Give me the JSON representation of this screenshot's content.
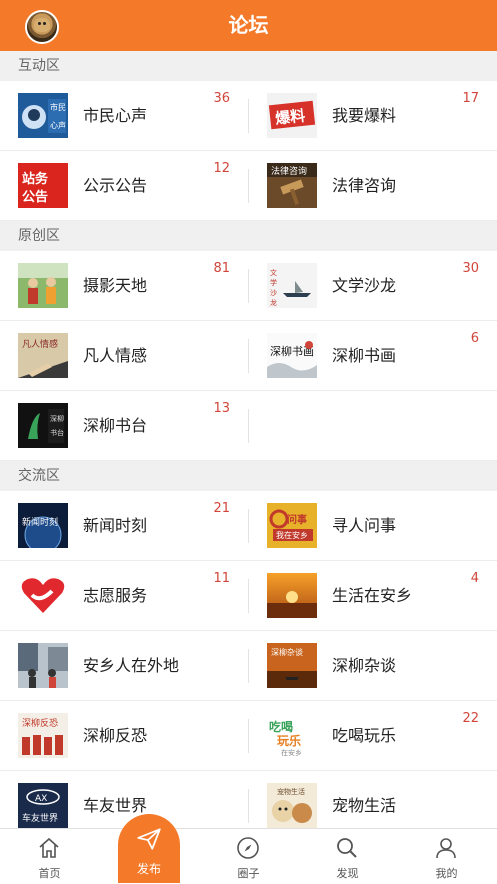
{
  "header": {
    "title": "论坛"
  },
  "sections": [
    {
      "name": "互动区",
      "rows": [
        [
          {
            "label": "市民心声",
            "count": "36"
          },
          {
            "label": "我要爆料",
            "count": "17"
          }
        ],
        [
          {
            "label": "公示公告",
            "count": "12"
          },
          {
            "label": "法律咨询",
            "count": ""
          }
        ]
      ]
    },
    {
      "name": "原创区",
      "rows": [
        [
          {
            "label": "摄影天地",
            "count": "81"
          },
          {
            "label": "文学沙龙",
            "count": "30"
          }
        ],
        [
          {
            "label": "凡人情感",
            "count": ""
          },
          {
            "label": "深柳书画",
            "count": "6"
          }
        ],
        [
          {
            "label": "深柳书台",
            "count": "13"
          },
          null
        ]
      ]
    },
    {
      "name": "交流区",
      "rows": [
        [
          {
            "label": "新闻时刻",
            "count": "21"
          },
          {
            "label": "寻人问事",
            "count": ""
          }
        ],
        [
          {
            "label": "志愿服务",
            "count": "11"
          },
          {
            "label": "生活在安乡",
            "count": "4"
          }
        ],
        [
          {
            "label": "安乡人在外地",
            "count": ""
          },
          {
            "label": "深柳杂谈",
            "count": ""
          }
        ],
        [
          {
            "label": "深柳反恐",
            "count": ""
          },
          {
            "label": "吃喝玩乐",
            "count": "22"
          }
        ],
        [
          {
            "label": "车友世界",
            "count": ""
          },
          {
            "label": "宠物生活",
            "count": ""
          }
        ]
      ]
    }
  ],
  "thumb_text": {
    "shimin": "市民心声",
    "baoliao": "爆料",
    "zhanwu": "站务公告",
    "falv": "法律咨询",
    "wenxue": "文学沙龙",
    "fanren": "凡人情感",
    "shuhua": "深柳书画",
    "shutai": "深柳书台",
    "xinwen": "新闻时刻",
    "xunren": "寻人问事",
    "xunren_sub": "我在安乡",
    "zatan": "深柳杂谈",
    "fankong": "深柳反恐",
    "chihe": "吃喝玩乐",
    "chihe_sub": "在安乡",
    "cheyou": "车友世界",
    "cheyou_logo": "AX",
    "chongwu": "宠物生活"
  },
  "tabbar": {
    "home": "首页",
    "publish": "发布",
    "circle": "圈子",
    "discover": "发现",
    "mine": "我的"
  },
  "colors": {
    "brand": "#f47a2a",
    "count": "#d0453a"
  }
}
